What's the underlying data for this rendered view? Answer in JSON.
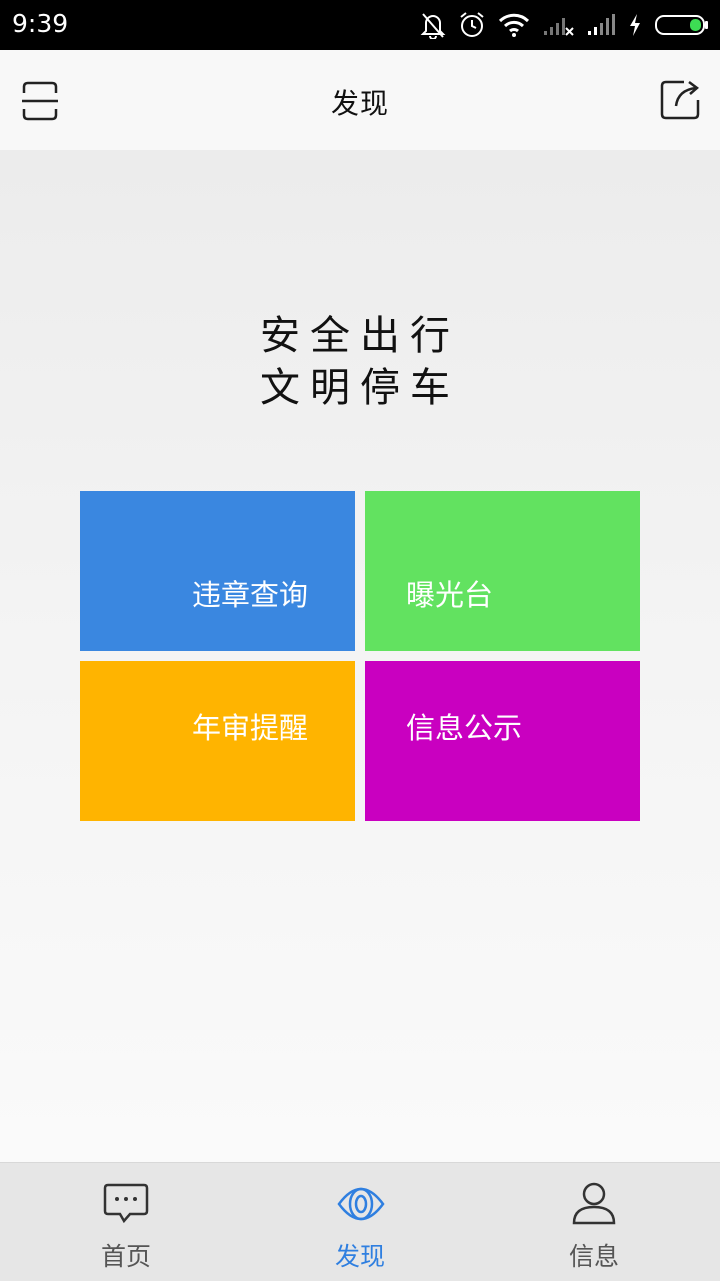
{
  "status_bar": {
    "time": "9:39",
    "icons": [
      "bell-off-icon",
      "alarm-icon",
      "wifi-icon",
      "signal-icon",
      "signal-icon",
      "charging-icon",
      "battery-icon"
    ]
  },
  "header": {
    "title": "发现",
    "left_icon": "scan-icon",
    "right_icon": "share-icon"
  },
  "slogan": {
    "line1": "安全出行",
    "line2": "文明停车"
  },
  "tiles": [
    {
      "label": "违章查询",
      "color": "#3a87e0"
    },
    {
      "label": "曝光台",
      "color": "#62e260"
    },
    {
      "label": "年审提醒",
      "color": "#ffb400"
    },
    {
      "label": "信息公示",
      "color": "#c900c0"
    }
  ],
  "tabbar": {
    "tabs": [
      {
        "label": "首页",
        "icon": "chat-icon"
      },
      {
        "label": "发现",
        "icon": "eye-icon",
        "active": true
      },
      {
        "label": "信息",
        "icon": "user-icon"
      }
    ],
    "active_color": "#2f7fe0"
  }
}
